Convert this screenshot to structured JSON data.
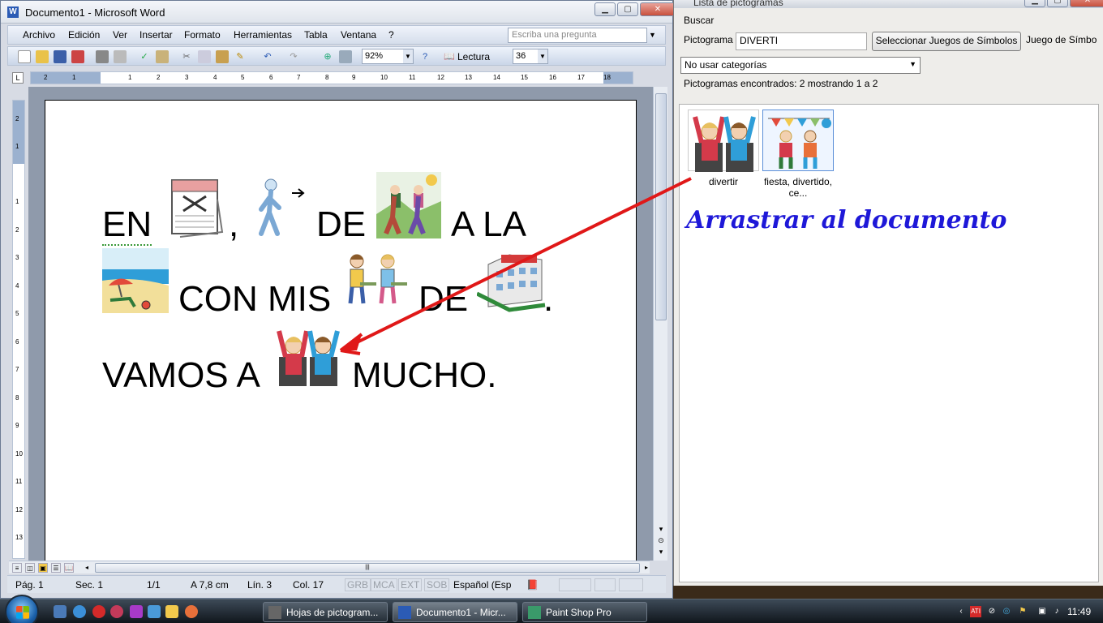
{
  "word": {
    "title": "Documento1 - Microsoft Word",
    "menu": [
      "Archivo",
      "Edición",
      "Ver",
      "Insertar",
      "Formato",
      "Herramientas",
      "Tabla",
      "Ventana",
      "?"
    ],
    "ask_placeholder": "Escriba una pregunta",
    "zoom": "92%",
    "reading_label": "Lectura",
    "font_size": "36",
    "ruler_h_numbers": [
      "2",
      "1",
      "1",
      "2",
      "3",
      "4",
      "5",
      "6",
      "7",
      "8",
      "9",
      "10",
      "11",
      "12",
      "13",
      "14",
      "15",
      "16",
      "17",
      "18"
    ],
    "ruler_v_numbers": [
      "2",
      "1",
      "1",
      "2",
      "3",
      "4",
      "5",
      "6",
      "7",
      "8",
      "9",
      "10",
      "11",
      "12",
      "13"
    ],
    "document": {
      "line1": {
        "w1": "EN",
        "w2": ",",
        "w3": "DE",
        "w4": "A LA"
      },
      "line2": {
        "w1": "CON MIS",
        "w2": "DE",
        "w3": "."
      },
      "line3": {
        "w1": "VAMOS A",
        "w2": "MUCHO."
      }
    },
    "status": {
      "page": "Pág. 1",
      "section": "Sec. 1",
      "pages": "1/1",
      "at": "A 7,8 cm",
      "line": "Lín. 3",
      "col": "Col. 17",
      "grb": "GRB",
      "mca": "MCA",
      "ext": "EXT",
      "sob": "SOB",
      "language": "Español (Esp"
    }
  },
  "pictograms": {
    "title": "Lista de pictogramas",
    "search_label": "Buscar",
    "pictogram_label": "Pictograma",
    "pictogram_value": "DIVERTI",
    "select_sets_button": "Seleccionar Juegos de Símbolos",
    "symbol_set_label": "Juego de Símbo",
    "category_value": "No usar categorías",
    "found_text": "Pictogramas encontrados: 2 mostrando 1 a 2",
    "results": [
      {
        "caption": "divertir"
      },
      {
        "caption": "fiesta, divertido, ce..."
      }
    ],
    "drag_note": "Arrastrar al documento"
  },
  "taskbar": {
    "tasks": [
      {
        "label": "Hojas de pictogram..."
      },
      {
        "label": "Documento1 - Micr..."
      },
      {
        "label": "Paint Shop Pro"
      }
    ],
    "clock": "11:49"
  },
  "colors": {
    "arrow": "#e01818",
    "drag_note": "#1e18d8",
    "word_chrome": "#d7dbe4"
  }
}
